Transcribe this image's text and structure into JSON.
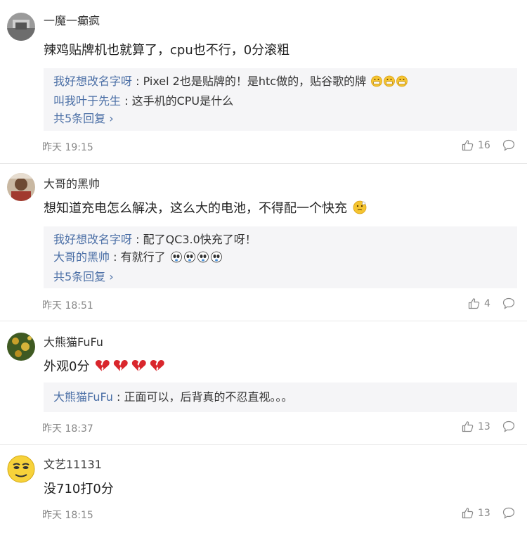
{
  "comments": [
    {
      "username": "一魔一癫疯",
      "text": "辣鸡贴牌机也就算了，cpu也不行，0分滚粗",
      "replies": [
        {
          "user": "我好想改名字呀",
          "text": "Pixel 2也是贴牌的！是htc做的，贴谷歌的牌",
          "emoji": "grin-emoji-x3"
        },
        {
          "user": "叫我叶于先生",
          "text": "这手机的CPU是什么"
        }
      ],
      "more": "共5条回复",
      "time": "昨天 19:15",
      "likes": "16"
    },
    {
      "username": "大哥的黑帅",
      "text": "想知道充电怎么解决，这么大的电池，不得配一个快充",
      "text_emoji": "thinking-emoji",
      "replies": [
        {
          "user": "我好想改名字呀",
          "text": "配了QC3.0快充了呀！"
        },
        {
          "user": "大哥的黑帅",
          "text": "有就行了",
          "emoji": "panda-emoji-x4"
        }
      ],
      "more": "共5条回复",
      "time": "昨天 18:51",
      "likes": "4"
    },
    {
      "username": "大熊猫FuFu",
      "text": "外观0分",
      "text_emoji": "broken-heart-emoji-x4",
      "replies": [
        {
          "user": "大熊猫FuFu",
          "text": "正面可以，后背真的不忍直视。。。"
        }
      ],
      "time": "昨天 18:37",
      "likes": "13"
    },
    {
      "username": "文艺11131",
      "text": "没710打0分",
      "replies": [],
      "time": "昨天 18:15",
      "likes": "13"
    }
  ],
  "colors": {
    "link": "#4b6fa6",
    "reply_bg": "#f5f5f7",
    "meta": "#888888"
  }
}
